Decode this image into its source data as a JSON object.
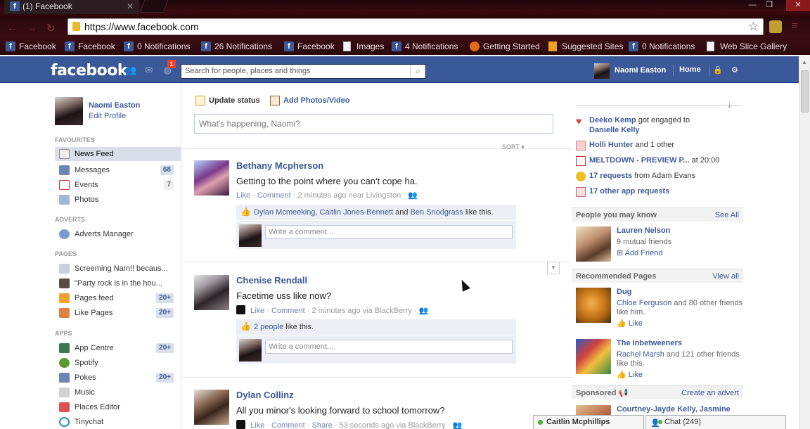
{
  "browser": {
    "tab_title": "(1) Facebook",
    "url": "https://www.facebook.com",
    "bookmarks": [
      "Facebook",
      "Facebook",
      "0 Notifications",
      "26 Notifications",
      "Facebook",
      "Images",
      "4 Notifications",
      "Getting Started",
      "Suggested Sites",
      "0 Notifications",
      "Web Slice Gallery"
    ]
  },
  "header": {
    "logo": "facebook",
    "notif_count": "1",
    "search_placeholder": "Search for people, places and things",
    "user_name": "Naomi Easton",
    "home": "Home"
  },
  "left": {
    "name": "Naomi Easton",
    "edit": "Edit Profile",
    "favourites_label": "FAVOURITES",
    "favourites": [
      {
        "label": "News Feed",
        "count": ""
      },
      {
        "label": "Messages",
        "count": "68"
      },
      {
        "label": "Events",
        "count": "7"
      },
      {
        "label": "Photos",
        "count": ""
      }
    ],
    "adverts_label": "ADVERTS",
    "adverts": [
      {
        "label": "Adverts Manager"
      }
    ],
    "pages_label": "PAGES",
    "pages": [
      {
        "label": "Screeming Nam!! becaus...",
        "count": ""
      },
      {
        "label": "\"Party rock is in the hou...",
        "count": ""
      },
      {
        "label": "Pages feed",
        "count": "20+"
      },
      {
        "label": "Like Pages",
        "count": "20+"
      }
    ],
    "apps_label": "APPS",
    "apps": [
      {
        "label": "App Centre",
        "count": "20+"
      },
      {
        "label": "Spotify",
        "count": ""
      },
      {
        "label": "Pokes",
        "count": "20+"
      },
      {
        "label": "Music",
        "count": ""
      },
      {
        "label": "Places Editor",
        "count": ""
      },
      {
        "label": "Tinychat",
        "count": ""
      }
    ]
  },
  "composer": {
    "update_status": "Update status",
    "add_photos": "Add Photos/Video",
    "placeholder": "What's happening, Naomi?",
    "sort": "SORT"
  },
  "posts": [
    {
      "name": "Bethany Mcpherson",
      "message": "Getting to the point where you can't cope ha.",
      "like": "Like",
      "comment": "Comment",
      "meta": "2 minutes ago near Livingston",
      "likers": [
        "Dylan Mcmeeking",
        "Caitlin Jones-Bennett",
        "Ben Snodgrass"
      ],
      "likes_join": ", ",
      "likes_and": " and ",
      "likes_suffix": " like this.",
      "write_comment": "Write a comment..."
    },
    {
      "name": "Chenise Rendall",
      "message": "Facetime uss like now?",
      "like": "Like",
      "comment": "Comment",
      "meta": "2 minutes ago via BlackBerry",
      "likes_people": "2 people",
      "likes_suffix": " like this.",
      "write_comment": "Write a comment..."
    },
    {
      "name": "Dylan Collinz",
      "message": "All you minor's looking forward to school tomorrow?",
      "like": "Like",
      "comment": "Comment",
      "share": "Share",
      "meta": "53 seconds ago via BlackBerry"
    }
  ],
  "right": {
    "events": [
      {
        "bold": "Deeko Kemp",
        "text": " got engaged to"
      },
      {
        "bold": "Danielle Kelly",
        "text": ""
      },
      {
        "bold": "Holli Hunter",
        "text": " and 1 other"
      },
      {
        "bold": "MELTDOWN - PREVIEW P...",
        "text": " at 20:00"
      },
      {
        "bold": "17 requests",
        "text": " from Adam Evans"
      },
      {
        "bold": "17 other app requests",
        "text": ""
      }
    ],
    "pymk_title": "People you may know",
    "pymk_link": "See All",
    "pymk": {
      "name": "Lauren Nelson",
      "sub": "9 mutual friends",
      "action": "Add Friend"
    },
    "rec_title": "Recommended Pages",
    "rec_link": "View all",
    "rec": [
      {
        "name": "Dug",
        "sub_link": "Chloe Ferguson",
        "sub_rest": " and 80 other friends like him.",
        "action": "Like"
      },
      {
        "name": "The Inbetweeners",
        "sub_link": "Rachel Marsh",
        "sub_rest": " and 121 other friends like this.",
        "action": "Like"
      }
    ],
    "sponsored_title": "Sponsored",
    "sponsored_link": "Create an advert",
    "sponsored_preview": "Courtney-Jayde Kelly, Jasmine"
  },
  "chat": {
    "contact": "Caitlin Mcphillips",
    "label": "Chat (249)"
  }
}
